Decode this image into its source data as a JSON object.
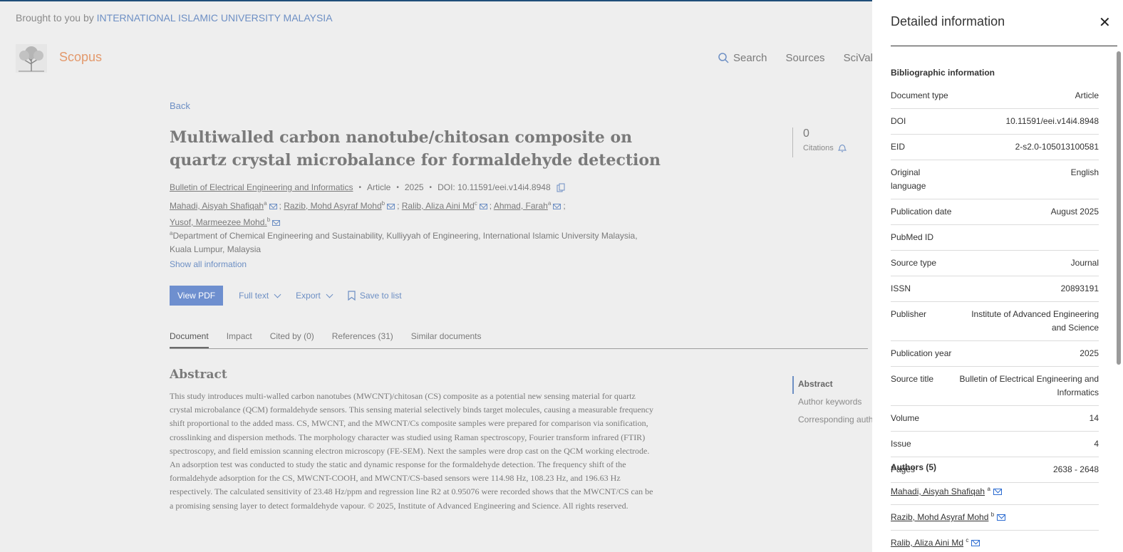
{
  "header": {
    "brought_by": "Brought to you by",
    "institution": "INTERNATIONAL ISLAMIC UNIVERSITY MALAYSIA",
    "brand": "Scopus",
    "nav": [
      {
        "label": "Search",
        "icon": "search-icon"
      },
      {
        "label": "Sources"
      },
      {
        "label": "SciVal"
      }
    ]
  },
  "doc": {
    "back": "Back",
    "title": "Multiwalled carbon nanotube/chitosan composite on quartz crystal microbalance for formaldehyde detection",
    "journal": "Bulletin of Electrical Engineering and Informatics",
    "type": "Article",
    "year": "2025",
    "doi": "DOI: 10.11591/eei.v14i4.8948",
    "citations_count": "0",
    "citations_label": "Citations",
    "authors": [
      {
        "name": "Mahadi, Aisyah Shafiqah",
        "aff": "a"
      },
      {
        "name": "Razib, Mohd Asyraf Mohd",
        "aff": "b"
      },
      {
        "name": "Ralib, Aliza Aini Md",
        "aff": "c"
      },
      {
        "name": "Ahmad, Farah",
        "aff": "a"
      },
      {
        "name": "Yusof, Marmeezee Mohd.",
        "aff": "b"
      }
    ],
    "affiliation_sup": "a",
    "affiliation": "Department of Chemical Engineering and Sustainability, Kulliyyah of Engineering, International Islamic University Malaysia, Kuala Lumpur, Malaysia",
    "show_all": "Show all information",
    "actions": {
      "view_pdf": "View PDF",
      "full_text": "Full text",
      "export": "Export",
      "save": "Save to list"
    },
    "tabs": [
      "Document",
      "Impact",
      "Cited by (0)",
      "References (31)",
      "Similar documents"
    ],
    "abstract_heading": "Abstract",
    "abstract": "This study introduces multi-walled carbon nanotubes (MWCNT)/chitosan (CS) composite as a potential new sensing material for quartz crystal microbalance (QCM) formaldehyde sensors. This sensing material selectively binds target molecules, causing a measurable frequency shift proportional to the added mass. CS, MWCNT, and the MWCNT/Cs composite samples were prepared for comparison via sonification, crosslinking and dispersion methods. The morphology character was studied using Raman spectroscopy, Fourier transform infrared (FTIR) spectroscopy, and field emission scanning electron microscopy (FE-SEM). Next the samples were drop cast on the QCM working electrode. An adsorption test was conducted to study the static and dynamic response for the formaldehyde detection. The frequency shift of the formaldehyde adsorption for the CS, MWCNT-COOH, and MWCNT/CS-based sensors were 114.98 Hz, 108.23 Hz, and 196.63 Hz respectively. The calculated sensitivity of 23.48 Hz/ppm and regression line R2 at 0.95076 were recorded shows that the MWCNT/CS can be a promising sensing layer to detect formaldehyde vapour. © 2025, Institute of Advanced Engineering and Science. All rights reserved.",
    "toc": [
      "Abstract",
      "Author keywords",
      "Corresponding auth"
    ]
  },
  "panel": {
    "title": "Detailed information",
    "biblio_heading": "Bibliographic information",
    "rows": [
      {
        "k": "Document type",
        "v": "Article"
      },
      {
        "k": "DOI",
        "v": "10.11591/eei.v14i4.8948"
      },
      {
        "k": "EID",
        "v": "2-s2.0-105013100581"
      },
      {
        "k": "Original language",
        "v": "English"
      },
      {
        "k": "Publication date",
        "v": "August 2025"
      },
      {
        "k": "PubMed ID",
        "v": ""
      },
      {
        "k": "Source type",
        "v": "Journal"
      },
      {
        "k": "ISSN",
        "v": "20893191"
      },
      {
        "k": "Publisher",
        "v": "Institute of Advanced Engineering and Science"
      },
      {
        "k": "Publication year",
        "v": "2025"
      },
      {
        "k": "Source title",
        "v": "Bulletin of Electrical Engineering and Informatics"
      },
      {
        "k": "Volume",
        "v": "14"
      },
      {
        "k": "Issue",
        "v": "4"
      },
      {
        "k": "Pages",
        "v": "2638 - 2648"
      }
    ],
    "authors_heading": "Authors (5)",
    "authors": [
      {
        "name": "Mahadi, Aisyah Shafiqah",
        "aff": "a"
      },
      {
        "name": "Razib, Mohd Asyraf Mohd",
        "aff": "b"
      },
      {
        "name": "Ralib, Aliza Aini Md",
        "aff": "c"
      }
    ]
  }
}
